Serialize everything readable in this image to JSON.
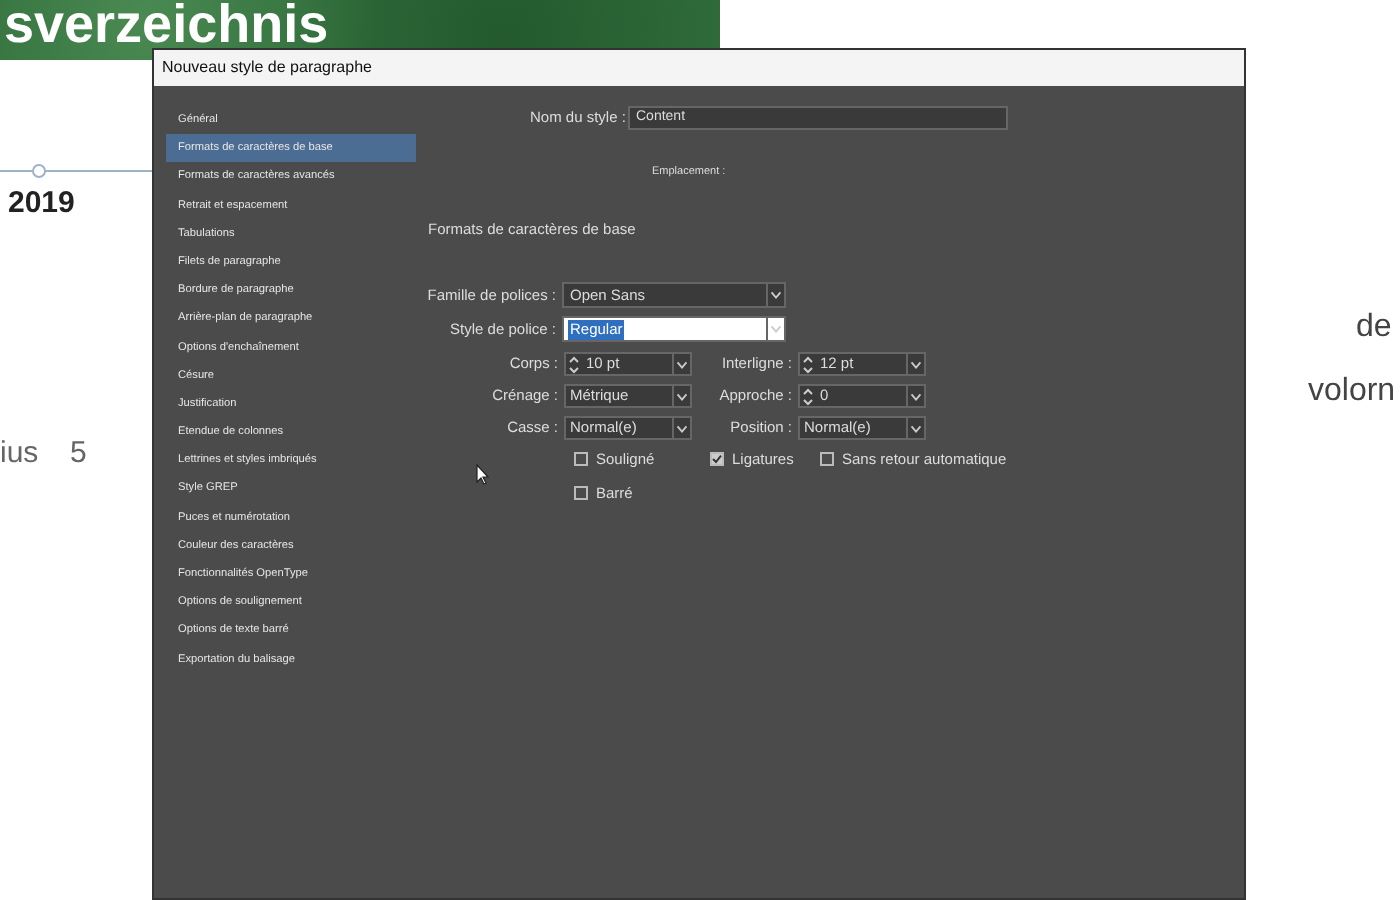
{
  "background": {
    "heading": "sverzeichnis",
    "year": "2019",
    "fragments": [
      "ius",
      "5",
      "de",
      "volorn"
    ]
  },
  "dialog": {
    "title": "Nouveau style de paragraphe",
    "sidebar": [
      {
        "label": "Général",
        "selected": false
      },
      {
        "label": "Formats de caractères de base",
        "selected": true
      },
      {
        "label": "Formats de caractères avancés",
        "selected": false
      },
      {
        "label": "Retrait et espacement",
        "selected": false
      },
      {
        "label": "Tabulations",
        "selected": false
      },
      {
        "label": "Filets de paragraphe",
        "selected": false
      },
      {
        "label": "Bordure de paragraphe",
        "selected": false
      },
      {
        "label": "Arrière-plan de paragraphe",
        "selected": false
      },
      {
        "label": "Options d'enchaînement",
        "selected": false
      },
      {
        "label": "Césure",
        "selected": false
      },
      {
        "label": "Justification",
        "selected": false
      },
      {
        "label": "Etendue de colonnes",
        "selected": false
      },
      {
        "label": "Lettrines et styles imbriqués",
        "selected": false
      },
      {
        "label": "Style GREP",
        "selected": false
      },
      {
        "label": "Puces et numérotation",
        "selected": false
      },
      {
        "label": "Couleur des caractères",
        "selected": false
      },
      {
        "label": "Fonctionnalités OpenType",
        "selected": false
      },
      {
        "label": "Options de soulignement",
        "selected": false
      },
      {
        "label": "Options de texte barré",
        "selected": false
      },
      {
        "label": "Exportation du balisage",
        "selected": false
      }
    ],
    "style_name": {
      "label": "Nom du style :",
      "value": "Content"
    },
    "location_label": "Emplacement :",
    "section_title": "Formats de caractères de base",
    "wide_fields": [
      {
        "label": "Famille de polices :",
        "value": "Open Sans",
        "text_selected": false
      },
      {
        "label": "Style de police :",
        "value": "Regular",
        "text_selected": true
      }
    ],
    "grid_fields": [
      {
        "label": "Corps :",
        "value": "10 pt",
        "kind": "spinner"
      },
      {
        "label": "Interligne :",
        "value": "12 pt",
        "kind": "spinner"
      },
      {
        "label": "Crénage :",
        "value": "Métrique",
        "kind": "dropdown"
      },
      {
        "label": "Approche :",
        "value": "0",
        "kind": "spinner"
      },
      {
        "label": "Casse :",
        "value": "Normal(e)",
        "kind": "dropdown"
      },
      {
        "label": "Position :",
        "value": "Normal(e)",
        "kind": "dropdown"
      }
    ],
    "checkboxes": [
      {
        "label": "Souligné",
        "checked": false
      },
      {
        "label": "Ligatures",
        "checked": true
      },
      {
        "label": "Sans retour automatique",
        "checked": false
      },
      {
        "label": "Barré",
        "checked": false
      }
    ]
  }
}
